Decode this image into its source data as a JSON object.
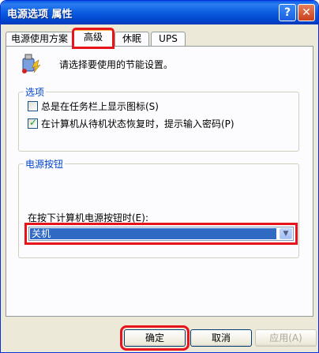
{
  "window": {
    "title": "电源选项 属性",
    "help_button": "?",
    "close_button": "✕"
  },
  "tabs": [
    {
      "label": "电源使用方案",
      "active": false
    },
    {
      "label": "高级",
      "active": true
    },
    {
      "label": "休眠",
      "active": false
    },
    {
      "label": "UPS",
      "active": false
    }
  ],
  "advanced": {
    "intro_text": "请选择要使用的节能设置。",
    "options_group": {
      "legend": "选项",
      "items": [
        {
          "label": "总是在任务栏上显示图标(S)",
          "checked": false
        },
        {
          "label": "在计算机从待机状态恢复时，提示输入密码(P)",
          "checked": true
        }
      ]
    },
    "power_buttons_group": {
      "legend": "电源按钮",
      "prompt": "在按下计算机电源按钮时(E):",
      "selected": "关机"
    }
  },
  "buttons": {
    "ok": "确定",
    "cancel": "取消",
    "apply": "应用(A)"
  },
  "colors": {
    "accent": "#0046d5",
    "highlight": "#e8141c",
    "selection": "#316ac5"
  }
}
